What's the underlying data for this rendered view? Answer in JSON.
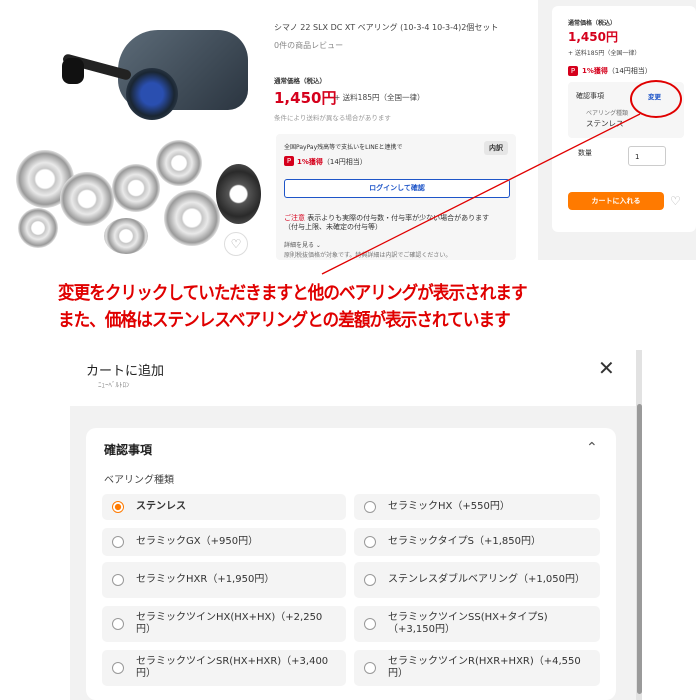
{
  "product": {
    "title": "シマノ 22 SLX DC XT ベアリング (10-3-4 10-3-4)2個セット",
    "reviews": "0件の商品レビュー",
    "price_label": "通常価格（税込）",
    "price": "1,450円",
    "shipping": "+ 送料185円（全国一律）",
    "price_note": "条件により送料が異なる場合があります",
    "paypay_text": "全国PayPay残高等で支払いをLINEと連携で",
    "paypay_badge": "内訳",
    "points": "1%獲得",
    "points_detail": "（14円相当）",
    "login_button": "ログインして確認",
    "notice_prefix": "ご注意",
    "notice_line1": "表示よりも実際の付与数・付与率が少ない場合があります",
    "notice_line2": "（付与上限、未確定の付与等）",
    "details_link": "詳細を見る ⌄",
    "tax_note": "原則税抜価格が対象です。特典詳細は内訳でご確認ください。",
    "fav_icon": "♡"
  },
  "sidebar": {
    "price_label": "通常価格（税込）",
    "price": "1,450円",
    "shipping": "+ 送料185円（全国一律）",
    "points": "1%獲得",
    "points_detail": "（14円相当）",
    "confirm_title": "確認事項",
    "change_link": "変更",
    "bearing_kind_label": "ベアリング種類",
    "bearing_kind_value": "ステンレス",
    "qty_label": "数量",
    "qty_value": "1",
    "cart_button": "カートに入れる",
    "heart": "♡"
  },
  "annotation": {
    "line1": "変更をクリックしていただきますと他のベアリングが表示されます",
    "line2": "また、価格はステンレスベアリングとの差額が表示されています",
    "color": "#e00000"
  },
  "modal": {
    "title": "カートに追加",
    "close": "✕",
    "subtitle": "ﾆｭｰﾍﾞﾙﾄﾛﾝ",
    "section_title": "確認事項",
    "section_chevron": "⌃",
    "option_label": "ベアリング種類",
    "options": [
      {
        "label": "ステンレス",
        "selected": true
      },
      {
        "label": "セラミックHX（+550円）",
        "selected": false
      },
      {
        "label": "セラミックGX（+950円）",
        "selected": false
      },
      {
        "label": "セラミックタイプS（+1,850円）",
        "selected": false
      },
      {
        "label": "セラミックHXR（+1,950円）",
        "selected": false
      },
      {
        "label": "ステンレスダブルベアリング（+1,050円）",
        "selected": false
      },
      {
        "label": "セラミックツインHX(HX+HX)（+2,250円）",
        "selected": false
      },
      {
        "label": "セラミックツインSS(HX+タイプS)（+3,150円）",
        "selected": false
      },
      {
        "label": "セラミックツインSR(HX+HXR)（+3,400円）",
        "selected": false
      },
      {
        "label": "セラミックツインR(HXR+HXR)（+4,550円）",
        "selected": false
      }
    ]
  },
  "colors": {
    "price_red": "#d5001c",
    "accent_orange": "#ff7a00",
    "link_blue": "#1e55c8"
  }
}
